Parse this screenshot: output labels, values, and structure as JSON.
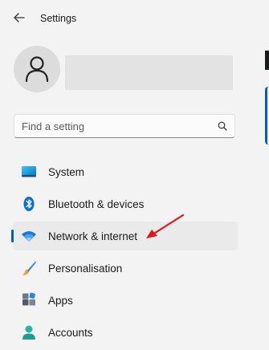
{
  "window": {
    "title": "Settings"
  },
  "search": {
    "placeholder": "Find a setting"
  },
  "sidebar": {
    "items": [
      {
        "label": "System",
        "icon": "monitor-icon"
      },
      {
        "label": "Bluetooth & devices",
        "icon": "bluetooth-icon"
      },
      {
        "label": "Network & internet",
        "icon": "wifi-icon",
        "selected": true
      },
      {
        "label": "Personalisation",
        "icon": "paint-brush-icon"
      },
      {
        "label": "Apps",
        "icon": "apps-icon"
      },
      {
        "label": "Accounts",
        "icon": "person-icon"
      }
    ]
  },
  "colors": {
    "accent": "#005fb8",
    "annotation_arrow": "#e0161b"
  }
}
